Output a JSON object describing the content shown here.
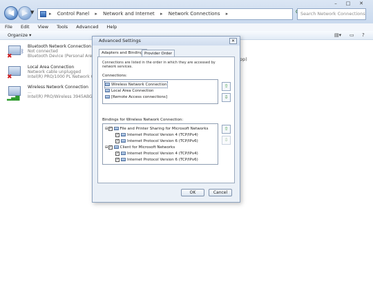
{
  "window": {
    "address_segments": [
      "Control Panel",
      "Network and Internet",
      "Network Connections"
    ],
    "search_placeholder": "Search Network Connections",
    "controls": [
      "–",
      "□",
      "✕"
    ]
  },
  "menu": [
    "File",
    "Edit",
    "View",
    "Tools",
    "Advanced",
    "Help"
  ],
  "toolbar": {
    "organize": "Organize ▾"
  },
  "connections": [
    {
      "name": "Bluetooth Network Connection",
      "status": "Not connected",
      "device": "Bluetooth Device (Personal Area ...",
      "state_icon": "red-x-icon"
    },
    {
      "name": "Local Area Connection",
      "status": "Network cable unplugged",
      "device": "Intel(R) PRO/1000 PL Network Co...",
      "state_icon": "red-x-icon"
    },
    {
      "name": "Wireless Network Connection",
      "status": "...",
      "device": "Intel(R) PRO/Wireless 3945ABG N...",
      "state_icon": "signal-bars-icon"
    }
  ],
  "background_fragment": "pp)",
  "dialog": {
    "title": "Advanced Settings",
    "close": "✕",
    "tabs": [
      "Adapters and Bindings",
      "Provider Order"
    ],
    "description": "Connections are listed in the order in which they are accessed by network services.",
    "connections_label": "Connections:",
    "connections": [
      "Wireless Network Connection",
      "Local Area Connection",
      "[Remote Access connections]"
    ],
    "bindings_label": "Bindings for Wireless Network Connection:",
    "bindings": [
      {
        "text": "File and Printer Sharing for Microsoft Networks",
        "level": 0,
        "checked": true
      },
      {
        "text": "Internet Protocol Version 4 (TCP/IPv4)",
        "level": 1,
        "checked": true
      },
      {
        "text": "Internet Protocol Version 6 (TCP/IPv6)",
        "level": 1,
        "checked": true
      },
      {
        "text": "Client for Microsoft Networks",
        "level": 0,
        "checked": true
      },
      {
        "text": "Internet Protocol Version 4 (TCP/IPv4)",
        "level": 1,
        "checked": true
      },
      {
        "text": "Internet Protocol Version 6 (TCP/IPv6)",
        "level": 1,
        "checked": true
      }
    ],
    "ok": "OK",
    "cancel": "Cancel"
  }
}
